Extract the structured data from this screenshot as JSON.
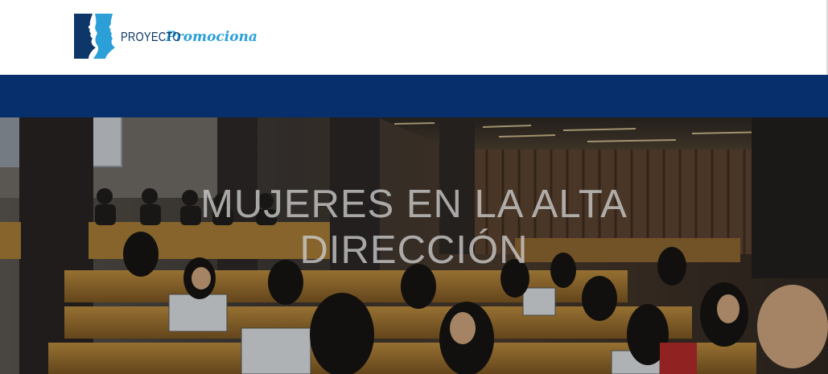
{
  "header": {
    "logo": {
      "word1": "PROYECTO",
      "word2": "Promociona",
      "icon": "profile-faces-logo-icon",
      "colors": {
        "dark": "#0d3768",
        "light": "#2a9fd8"
      }
    }
  },
  "navbar": {
    "color": "#072f6b"
  },
  "hero": {
    "title_line1": "MUJERES EN LA ALTA",
    "title_line2": "DIRECCIÓN",
    "image": "conference-auditorium-photo"
  }
}
